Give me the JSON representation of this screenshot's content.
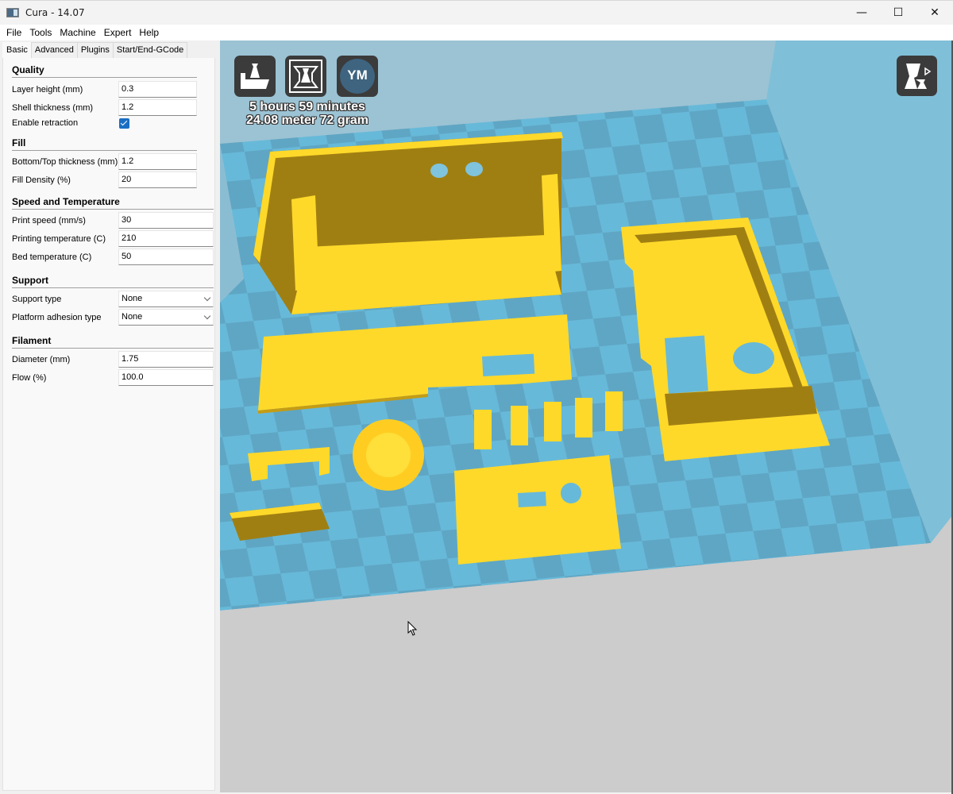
{
  "window": {
    "title": "Cura - 14.07",
    "controls": {
      "minimize": "—",
      "maximize": "☐",
      "close": "✕"
    }
  },
  "menu": [
    "File",
    "Tools",
    "Machine",
    "Expert",
    "Help"
  ],
  "tabs": [
    {
      "label": "Basic",
      "active": true
    },
    {
      "label": "Advanced",
      "active": false
    },
    {
      "label": "Plugins",
      "active": false
    },
    {
      "label": "Start/End-GCode",
      "active": false
    }
  ],
  "sections": {
    "quality": {
      "title": "Quality",
      "layer_height": {
        "label": "Layer height (mm)",
        "value": "0.3"
      },
      "shell_thickness": {
        "label": "Shell thickness (mm)",
        "value": "1.2"
      },
      "enable_retraction": {
        "label": "Enable retraction",
        "checked": true
      }
    },
    "fill": {
      "title": "Fill",
      "bottom_top": {
        "label": "Bottom/Top thickness (mm)",
        "value": "1.2"
      },
      "fill_density": {
        "label": "Fill Density (%)",
        "value": "20"
      }
    },
    "speed": {
      "title": "Speed and Temperature",
      "print_speed": {
        "label": "Print speed (mm/s)",
        "value": "30"
      },
      "print_temp": {
        "label": "Printing temperature (C)",
        "value": "210"
      },
      "bed_temp": {
        "label": "Bed temperature (C)",
        "value": "50"
      }
    },
    "support": {
      "title": "Support",
      "support_type": {
        "label": "Support type",
        "value": "None"
      },
      "adhesion": {
        "label": "Platform adhesion type",
        "value": "None"
      }
    },
    "filament": {
      "title": "Filament",
      "diameter": {
        "label": "Diameter (mm)",
        "value": "1.75"
      },
      "flow": {
        "label": "Flow (%)",
        "value": "100.0"
      }
    }
  },
  "viewport": {
    "toolbar": {
      "load": "load-model",
      "save": "save-toolpath",
      "ym": "YM"
    },
    "print_time": "5 hours 59 minutes",
    "print_material": "24.08 meter 72 gram",
    "view_mode": "view-mode",
    "colors": {
      "model": "#ffd92a",
      "model_shadow": "#a07f12",
      "bed_light": "#67b9d9",
      "bed_dark": "#5fa6c4",
      "wall_back": "#9bc3d4",
      "wall_side": "#80bfd8",
      "floor": "#cccccc"
    }
  }
}
